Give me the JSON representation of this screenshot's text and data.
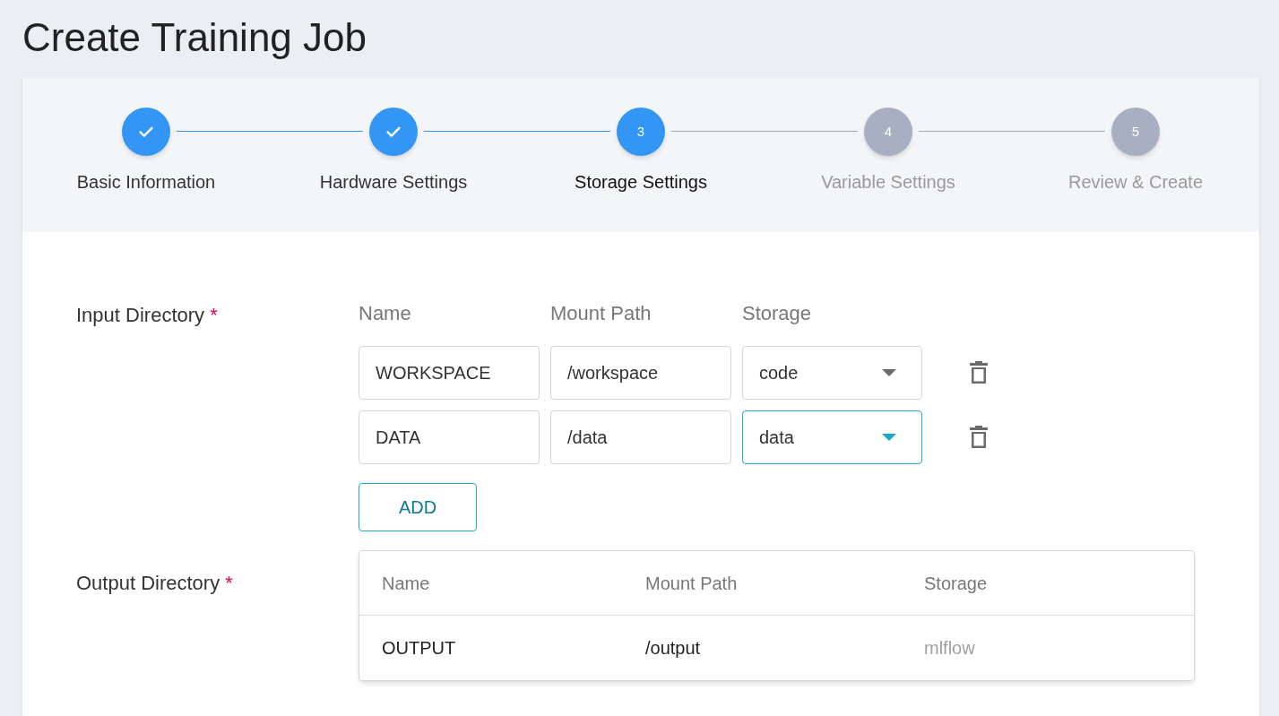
{
  "page": {
    "title": "Create Training Job"
  },
  "steps": [
    {
      "label": "Basic Information",
      "kind": "done"
    },
    {
      "label": "Hardware Settings",
      "kind": "done"
    },
    {
      "number": "3",
      "label": "Storage Settings",
      "kind": "current"
    },
    {
      "number": "4",
      "label": "Variable Settings",
      "kind": "pending"
    },
    {
      "number": "5",
      "label": "Review & Create",
      "kind": "pending"
    }
  ],
  "input_directory": {
    "label": "Input Directory",
    "required": "*",
    "columns": [
      "Name",
      "Mount Path",
      "Storage"
    ],
    "rows": [
      {
        "name": "WORKSPACE",
        "mount_path": "/workspace",
        "storage": "code",
        "focused": false
      },
      {
        "name": "DATA",
        "mount_path": "/data",
        "storage": "data",
        "focused": true
      }
    ],
    "add_button": "ADD"
  },
  "output_directory": {
    "label": "Output Directory",
    "required": "*",
    "columns": [
      "Name",
      "Mount Path",
      "Storage"
    ],
    "rows": [
      {
        "name": "OUTPUT",
        "mount_path": "/output",
        "storage": "mlflow"
      }
    ]
  }
}
